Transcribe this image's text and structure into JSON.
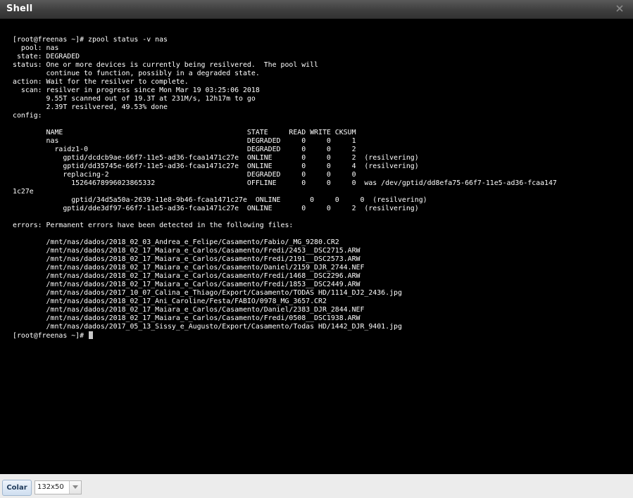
{
  "window": {
    "title": "Shell",
    "close_icon": "close-icon"
  },
  "terminal": {
    "output": "[root@freenas ~]# zpool status -v nas\n  pool: nas\n state: DEGRADED\nstatus: One or more devices is currently being resilvered.  The pool will\n        continue to function, possibly in a degraded state.\naction: Wait for the resilver to complete.\n  scan: resilver in progress since Mon Mar 19 03:25:06 2018\n        9.55T scanned out of 19.3T at 231M/s, 12h17m to go\n        2.39T resilvered, 49.53% done\nconfig:\n\n        NAME                                            STATE     READ WRITE CKSUM\n        nas                                             DEGRADED     0     0     1\n          raidz1-0                                      DEGRADED     0     0     2\n            gptid/dcdcb9ae-66f7-11e5-ad36-fcaa1471c27e  ONLINE       0     0     2  (resilvering)\n            gptid/dd35745e-66f7-11e5-ad36-fcaa1471c27e  ONLINE       0     0     4  (resilvering)\n            replacing-2                                 DEGRADED     0     0     0\n              15264678996023865332                      OFFLINE      0     0     0  was /dev/gptid/dd8efa75-66f7-11e5-ad36-fcaa147\n1c27e\n              gptid/34d5a50a-2639-11e8-9b46-fcaa1471c27e  ONLINE       0     0     0  (resilvering)\n            gptid/dde3df97-66f7-11e5-ad36-fcaa1471c27e  ONLINE       0     0     2  (resilvering)\n\nerrors: Permanent errors have been detected in the following files:\n\n        /mnt/nas/dados/2018_02_03_Andrea_e_Felipe/Casamento/Fabio/_MG_9280.CR2\n        /mnt/nas/dados/2018_02_17_Maiara_e_Carlos/Casamento/Fredi/2453__DSC2715.ARW\n        /mnt/nas/dados/2018_02_17_Maiara_e_Carlos/Casamento/Fredi/2191__DSC2573.ARW\n        /mnt/nas/dados/2018_02_17_Maiara_e_Carlos/Casamento/Daniel/2159_DJR_2744.NEF\n        /mnt/nas/dados/2018_02_17_Maiara_e_Carlos/Casamento/Fredi/1468__DSC2296.ARW\n        /mnt/nas/dados/2018_02_17_Maiara_e_Carlos/Casamento/Fredi/1853__DSC2449.ARW\n        /mnt/nas/dados/2017_10_07_Calina_e_Thiago/Export/Casamento/TODAS HD/1114_DJ2_2436.jpg\n        /mnt/nas/dados/2018_02_17_Ani_Caroline/Festa/FABIO/0978_MG_3657.CR2\n        /mnt/nas/dados/2018_02_17_Maiara_e_Carlos/Casamento/Daniel/2383_DJR_2844.NEF\n        /mnt/nas/dados/2018_02_17_Maiara_e_Carlos/Casamento/Fredi/0508__DSC1938.ARW\n        /mnt/nas/dados/2017_05_13_Sissy_e_Augusto/Export/Casamento/Todas HD/1442_DJR_9401.jpg",
    "prompt": "[root@freenas ~]# "
  },
  "toolbar": {
    "paste_label": "Colar",
    "size_value": "132x50",
    "dropdown_icon": "chevron-down-icon"
  }
}
